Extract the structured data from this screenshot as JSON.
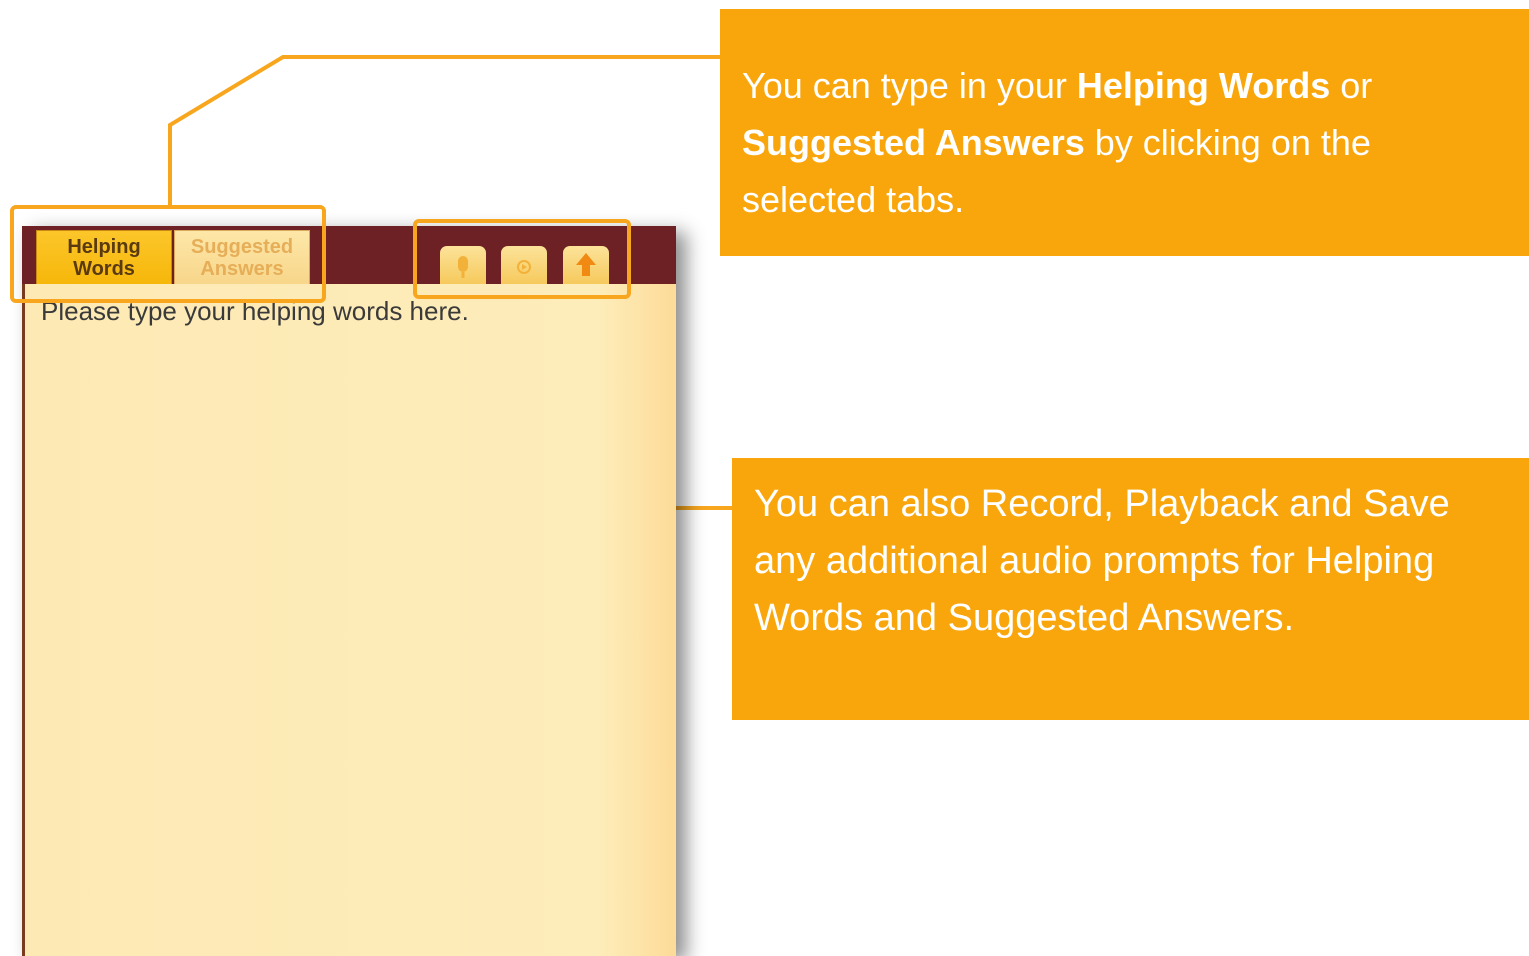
{
  "panel": {
    "tabs": [
      {
        "label": "Helping\nWords",
        "selected": true
      },
      {
        "label": "Suggested\nAnswers",
        "selected": false
      }
    ],
    "toolbar": {
      "record_icon": "microphone-icon",
      "playback_icon": "play-icon",
      "save_icon": "upload-arrow-icon"
    },
    "notes_text": "Please type your helping words here."
  },
  "callouts": {
    "tabs": {
      "part1": "You can type in your ",
      "bold1": "Helping Words",
      "part2": " or ",
      "bold2": "Suggested Answers",
      "part3": " by clicking on the selected tabs."
    },
    "audio": {
      "text": "You can also Record, Playback and Save any additional audio prompts for Helping Words and Suggested Answers."
    }
  },
  "colors": {
    "accent": "#f9a60d",
    "header": "#6e2124",
    "tab_selected": "#fcc62a",
    "body": "#fdedba"
  }
}
